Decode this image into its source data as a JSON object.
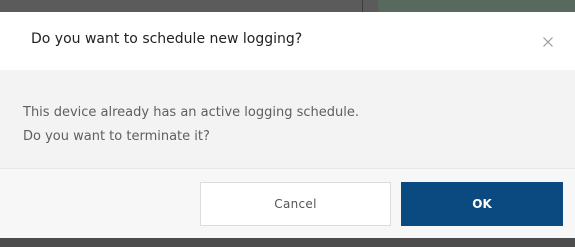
{
  "dialog": {
    "title": "Do you want to schedule new logging?",
    "close_icon": "close-icon",
    "message_lines": [
      "This device already has an active logging schedule.",
      "Do you want to terminate it?"
    ],
    "buttons": {
      "cancel_label": "Cancel",
      "ok_label": "OK"
    }
  },
  "colors": {
    "primary": "#0a4a80",
    "body_background": "#f3f3f3",
    "footer_background": "#f7f7f7",
    "backdrop": "#4a4a4a"
  }
}
